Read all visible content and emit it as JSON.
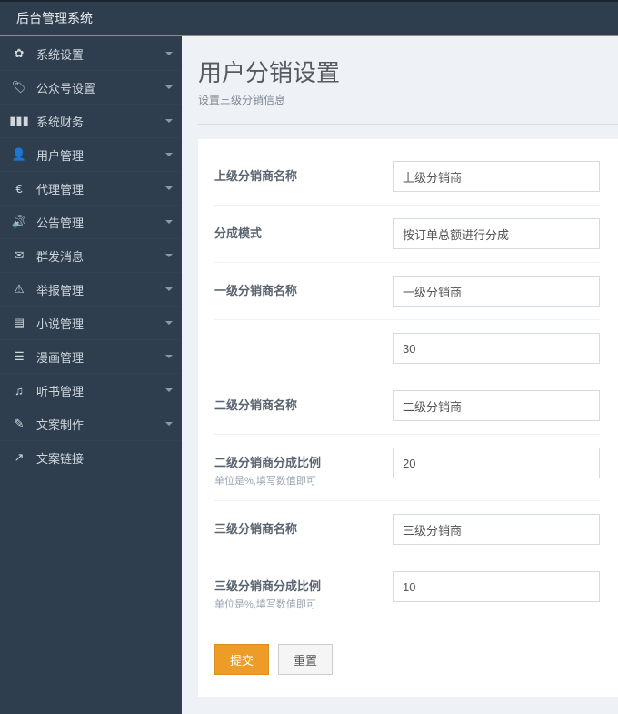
{
  "topbar": {
    "title": "后台管理系统"
  },
  "sidebar": {
    "items": [
      {
        "icon": "gear-icon",
        "glyph": "✿",
        "label": "系统设置",
        "expandable": true
      },
      {
        "icon": "tag-icon",
        "glyph": "🏷",
        "label": "公众号设置",
        "expandable": true
      },
      {
        "icon": "chart-icon",
        "glyph": "▮▮▮",
        "label": "系统财务",
        "expandable": true
      },
      {
        "icon": "user-icon",
        "glyph": "👤",
        "label": "用户管理",
        "expandable": true
      },
      {
        "icon": "euro-icon",
        "glyph": "€",
        "label": "代理管理",
        "expandable": true
      },
      {
        "icon": "speaker-icon",
        "glyph": "🔊",
        "label": "公告管理",
        "expandable": true
      },
      {
        "icon": "mail-icon",
        "glyph": "✉",
        "label": "群发消息",
        "expandable": true
      },
      {
        "icon": "warning-icon",
        "glyph": "⚠",
        "label": "举报管理",
        "expandable": true
      },
      {
        "icon": "book-icon",
        "glyph": "▤",
        "label": "小说管理",
        "expandable": true
      },
      {
        "icon": "list-icon",
        "glyph": "☰",
        "label": "漫画管理",
        "expandable": true
      },
      {
        "icon": "audio-icon",
        "glyph": "♫",
        "label": "听书管理",
        "expandable": true
      },
      {
        "icon": "pencil-icon",
        "glyph": "✎",
        "label": "文案制作",
        "expandable": true
      },
      {
        "icon": "link-icon",
        "glyph": "↗",
        "label": "文案链接",
        "expandable": false
      }
    ]
  },
  "page": {
    "title": "用户分销设置",
    "subtitle": "设置三级分销信息"
  },
  "form": {
    "fields": [
      {
        "label": "上级分销商名称",
        "hint": "",
        "value": "上级分销商",
        "type": "text"
      },
      {
        "label": "分成模式",
        "hint": "",
        "value": "按订单总额进行分成",
        "type": "select"
      },
      {
        "label": "一级分销商名称",
        "hint": "",
        "value": "一级分销商",
        "type": "text"
      },
      {
        "label": "",
        "hint": "",
        "value": "30",
        "type": "text"
      },
      {
        "label": "二级分销商名称",
        "hint": "",
        "value": "二级分销商",
        "type": "text"
      },
      {
        "label": "二级分销商分成比例",
        "hint": "单位是%,填写数值即可",
        "value": "20",
        "type": "text"
      },
      {
        "label": "三级分销商名称",
        "hint": "",
        "value": "三级分销商",
        "type": "text"
      },
      {
        "label": "三级分销商分成比例",
        "hint": "单位是%,填写数值即可",
        "value": "10",
        "type": "text"
      }
    ],
    "actions": {
      "submit": "提交",
      "reset": "重置"
    }
  }
}
